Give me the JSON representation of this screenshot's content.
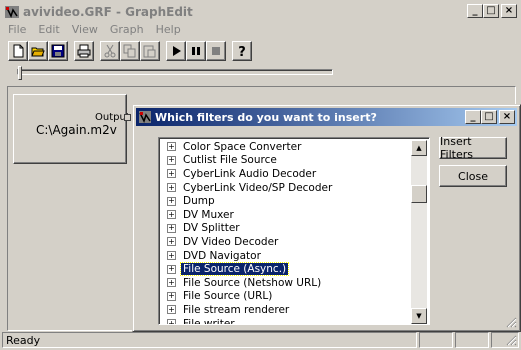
{
  "window": {
    "title": "avivideo.GRF - GraphEdit",
    "minimize": "_",
    "maximize": "□",
    "close": "×"
  },
  "menu": [
    "File",
    "Edit",
    "View",
    "Graph",
    "Help"
  ],
  "toolbar": [
    {
      "icon": "new-icon"
    },
    {
      "icon": "open-icon"
    },
    {
      "icon": "save-icon"
    },
    {
      "icon": "print-icon"
    },
    {
      "icon": "cut-icon"
    },
    {
      "icon": "copy-icon"
    },
    {
      "icon": "paste-icon"
    },
    {
      "icon": "play-icon"
    },
    {
      "icon": "pause-icon"
    },
    {
      "icon": "stop-icon"
    },
    {
      "icon": "help-icon"
    }
  ],
  "graph": {
    "filter_name": "C:\\Again.m2v",
    "pin_label": "Output"
  },
  "status": {
    "text": "Ready"
  },
  "dialog": {
    "title": "Which filters do you want to insert?",
    "insert_button": "Insert Filters",
    "close_button": "Close",
    "selected_index": 9,
    "filters": [
      "Color Space Converter",
      "Cutlist File Source",
      "CyberLink Audio Decoder",
      "CyberLink Video/SP Decoder",
      "Dump",
      "DV Muxer",
      "DV Splitter",
      "DV Video Decoder",
      "DVD Navigator",
      "File Source (Async.)",
      "File Source (Netshow URL)",
      "File Source (URL)",
      "File stream renderer",
      "File writer"
    ],
    "scroll_position": 0.22
  },
  "colors": {
    "face": "#d4d0c8",
    "title_active": "#0a246a",
    "title_gradient_end": "#a6caf0",
    "selection": "#0a246a"
  }
}
